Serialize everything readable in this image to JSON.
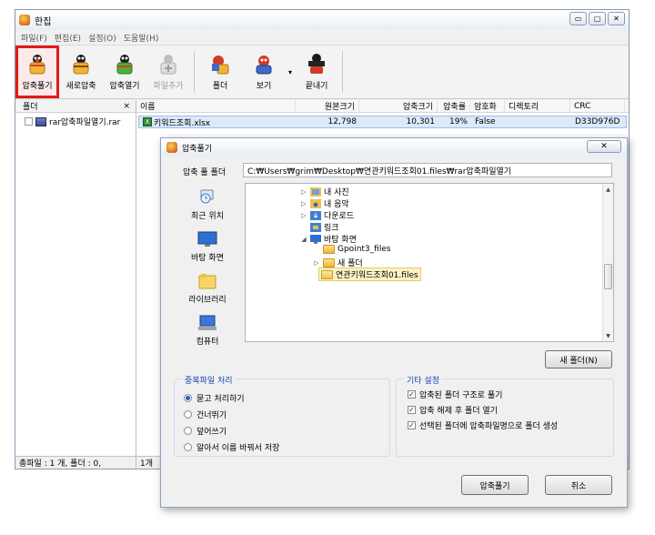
{
  "window": {
    "title": "한집",
    "controls": [
      "▭",
      "▢",
      "✕"
    ]
  },
  "menu": [
    "파일(F)",
    "편집(E)",
    "설정(O)",
    "도움말(H)"
  ],
  "toolbar": {
    "buttons": [
      {
        "label": "압축풀기",
        "icon": "extract-icon",
        "active": true
      },
      {
        "label": "새로압축",
        "icon": "new-archive-icon"
      },
      {
        "label": "압축열기",
        "icon": "open-archive-icon"
      },
      {
        "label": "파일추가",
        "icon": "add-file-icon",
        "disabled": true
      },
      {
        "label": "폴더",
        "icon": "folder-icon"
      },
      {
        "label": "보기",
        "icon": "view-icon"
      },
      {
        "label": "끝내기",
        "icon": "exit-icon"
      }
    ],
    "dropdown_glyph": "▾"
  },
  "left_pane": {
    "header": "폴더",
    "close_glyph": "×",
    "tree_item": "rar압축파일열기.rar",
    "status": "총파일 : 1 개, 폴더 : 0,"
  },
  "file_list": {
    "columns": [
      "이름",
      "원본크기",
      "압축크기",
      "압축률",
      "암호화",
      "디렉토리",
      "CRC"
    ],
    "rows": [
      {
        "name": "키워드조회.xlsx",
        "original": "12,798",
        "compressed": "10,301",
        "ratio": "19%",
        "encrypted": "False",
        "directory": "",
        "crc": "D33D976D"
      }
    ],
    "status": "1개"
  },
  "dialog": {
    "title": "압축풀기",
    "close_glyph": "✕",
    "path_label": "압축 풀 폴더",
    "path_value": "C:₩Users₩grim₩Desktop₩연관키워드조회01.files₩rar압축파일열기",
    "places": [
      {
        "label": "최근 위치",
        "icon": "recent-places-icon"
      },
      {
        "label": "바탕 화면",
        "icon": "desktop-icon"
      },
      {
        "label": "라이브러리",
        "icon": "libraries-icon"
      },
      {
        "label": "컴퓨터",
        "icon": "computer-icon"
      }
    ],
    "tree": [
      {
        "label": "내 사진",
        "level": 0,
        "arrow": "▷"
      },
      {
        "label": "내 음악",
        "level": 0,
        "arrow": "▷"
      },
      {
        "label": "다운로드",
        "level": 0,
        "arrow": "▷"
      },
      {
        "label": "링크",
        "level": 0,
        "arrow": ""
      },
      {
        "label": "바탕 화면",
        "level": 0,
        "arrow": "◢"
      },
      {
        "label": "Gpoint3_files",
        "level": 1,
        "arrow": ""
      },
      {
        "label": "새 폴더",
        "level": 1,
        "arrow": "▷"
      },
      {
        "label": "연관키워드조회01.files",
        "level": 1,
        "arrow": "",
        "selected": true
      }
    ],
    "new_folder_button": "새 폴더(N)",
    "duplicate_group": {
      "label": "중복파일 처리",
      "options": [
        {
          "label": "묻고 처리하기",
          "checked": true
        },
        {
          "label": "건너뛰기",
          "checked": false
        },
        {
          "label": "덮어쓰기",
          "checked": false
        },
        {
          "label": "알아서 이름 바꿔서 저장",
          "checked": false
        }
      ]
    },
    "other_group": {
      "label": "기타 설정",
      "options": [
        {
          "label": "압축된 폴더 구조로 풀기",
          "checked": true
        },
        {
          "label": "압축 해제 후 폴더 열기",
          "checked": true
        },
        {
          "label": "선택된 폴더에 압축파일명으로 폴더 생성",
          "checked": true
        }
      ]
    },
    "ok_button": "압축풀기",
    "cancel_button": "취소"
  },
  "colors": {
    "accent_red": "#e31919",
    "link_blue": "#1a44b0",
    "selection": "#dbe9f8"
  }
}
